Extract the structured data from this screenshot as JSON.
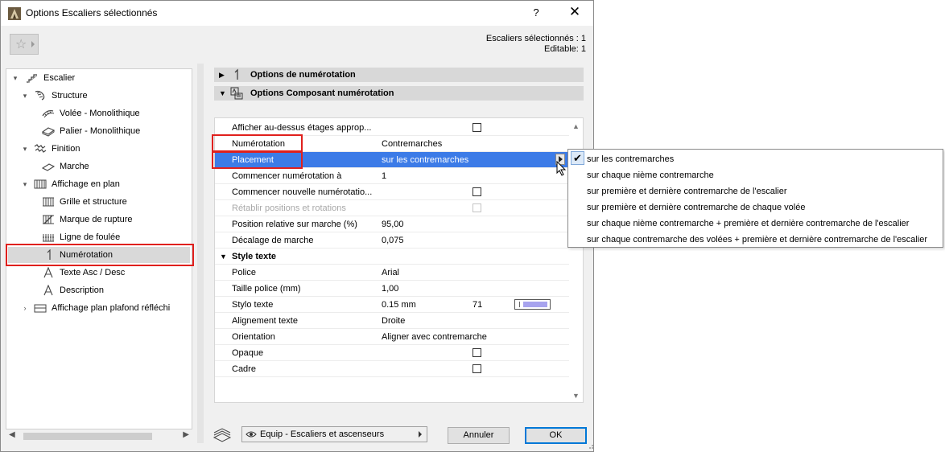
{
  "window": {
    "title": "Options Escaliers sélectionnés",
    "help": "?",
    "close": "✕"
  },
  "selection_info": {
    "line1": "Escaliers sélectionnés : 1",
    "line2": "Editable: 1"
  },
  "tree": [
    {
      "label": "Escalier",
      "icon": "stair-icon",
      "expanded": true
    },
    {
      "label": "Structure",
      "icon": "structure-icon",
      "expanded": true
    },
    {
      "label": "Volée - Monolithique",
      "icon": "flight-icon"
    },
    {
      "label": "Palier - Monolithique",
      "icon": "landing-icon"
    },
    {
      "label": "Finition",
      "icon": "finish-icon",
      "expanded": true
    },
    {
      "label": "Marche",
      "icon": "tread-icon"
    },
    {
      "label": "Affichage en plan",
      "icon": "plan-display-icon",
      "expanded": true
    },
    {
      "label": "Grille et structure",
      "icon": "grid-icon"
    },
    {
      "label": "Marque de rupture",
      "icon": "break-mark-icon"
    },
    {
      "label": "Ligne de foulée",
      "icon": "walking-line-icon"
    },
    {
      "label": "Numérotation",
      "icon": "numbering-icon",
      "selected": true
    },
    {
      "label": "Texte Asc / Desc",
      "icon": "text-a-icon"
    },
    {
      "label": "Description",
      "icon": "text-a-icon"
    },
    {
      "label": "Affichage plan plafond réfléchi",
      "icon": "rcp-icon",
      "expanded": false
    }
  ],
  "sections": {
    "numbering_options": "Options de numérotation",
    "component_options": "Options Composant numérotation"
  },
  "properties": [
    {
      "label": "Afficher au-dessus étages approp...",
      "checkbox": false
    },
    {
      "label": "Numérotation",
      "value": "Contremarches"
    },
    {
      "label": "Placement",
      "value": "sur les contremarches",
      "selected": true
    },
    {
      "label": "Commencer numérotation à",
      "value": "1"
    },
    {
      "label": "Commencer nouvelle numérotatio...",
      "checkbox": false
    },
    {
      "label": "Rétablir positions et rotations",
      "checkbox": false,
      "disabled": true
    },
    {
      "label": "Position relative sur marche (%)",
      "value": "95,00"
    },
    {
      "label": "Décalage de marche",
      "value": "0,075"
    },
    {
      "group": "Style texte"
    },
    {
      "label": "Police",
      "value": "Arial"
    },
    {
      "label": "Taille police (mm)",
      "value": "1,00"
    },
    {
      "label": "Stylo texte",
      "value": "0.15 mm",
      "value2": "71",
      "pen_color": "#a7a3ee"
    },
    {
      "label": "Alignement texte",
      "value": "Droite"
    },
    {
      "label": "Orientation",
      "value": "Aligner avec contremarche"
    },
    {
      "label": "Opaque",
      "checkbox": false
    },
    {
      "label": "Cadre",
      "checkbox": false
    }
  ],
  "placement_menu": {
    "checked_index": 0,
    "items": [
      "sur les contremarches",
      "sur chaque nième contremarche",
      "sur première et dernière contremarche de l'escalier",
      "sur première et dernière contremarche de chaque volée",
      "sur chaque nième contremarche + première et dernière contremarche de l'escalier",
      "sur chaque contremarche des volées + première et dernière contremarche de l'escalier"
    ]
  },
  "footer": {
    "layer": "Equip - Escaliers et ascenseurs",
    "cancel": "Annuler",
    "ok": "OK"
  },
  "colors": {
    "selection": "#3c7be7",
    "highlight_box": "#e0201d",
    "header_bg": "#d8d8d8"
  }
}
